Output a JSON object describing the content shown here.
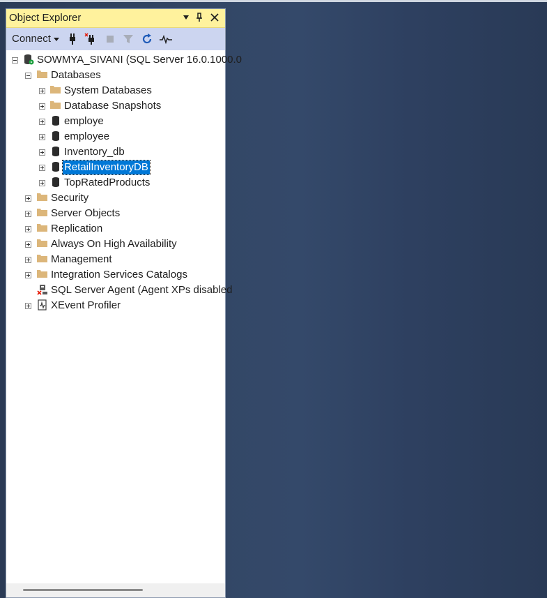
{
  "panel": {
    "title": "Object Explorer",
    "title_buttons": [
      "dropdown-arrow-icon",
      "pin-icon",
      "close-icon"
    ],
    "toolbar": {
      "connect_label": "Connect",
      "icons": [
        "connect-plug-icon",
        "disconnect-plug-icon",
        "stop-icon",
        "filter-icon",
        "refresh-icon",
        "activity-monitor-icon"
      ]
    }
  },
  "tree": {
    "server": "SOWMYA_SIVANI (SQL Server 16.0.1000.0",
    "databases": "Databases",
    "db_children": [
      "System Databases",
      "Database Snapshots",
      "employe",
      "employee",
      "Inventory_db",
      "RetailInventoryDB",
      "TopRatedProducts"
    ],
    "selected": "RetailInventoryDB",
    "server_children": [
      "Security",
      "Server Objects",
      "Replication",
      "Always On High Availability",
      "Management",
      "Integration Services Catalogs"
    ],
    "agent": "SQL Server Agent (Agent XPs disabled",
    "xevent": "XEvent Profiler"
  },
  "colors": {
    "title_bg": "#fff29d",
    "toolbar_bg": "#ccd5f0",
    "selection": "#0078d7",
    "desktop_bg": "#2d3e5c"
  }
}
